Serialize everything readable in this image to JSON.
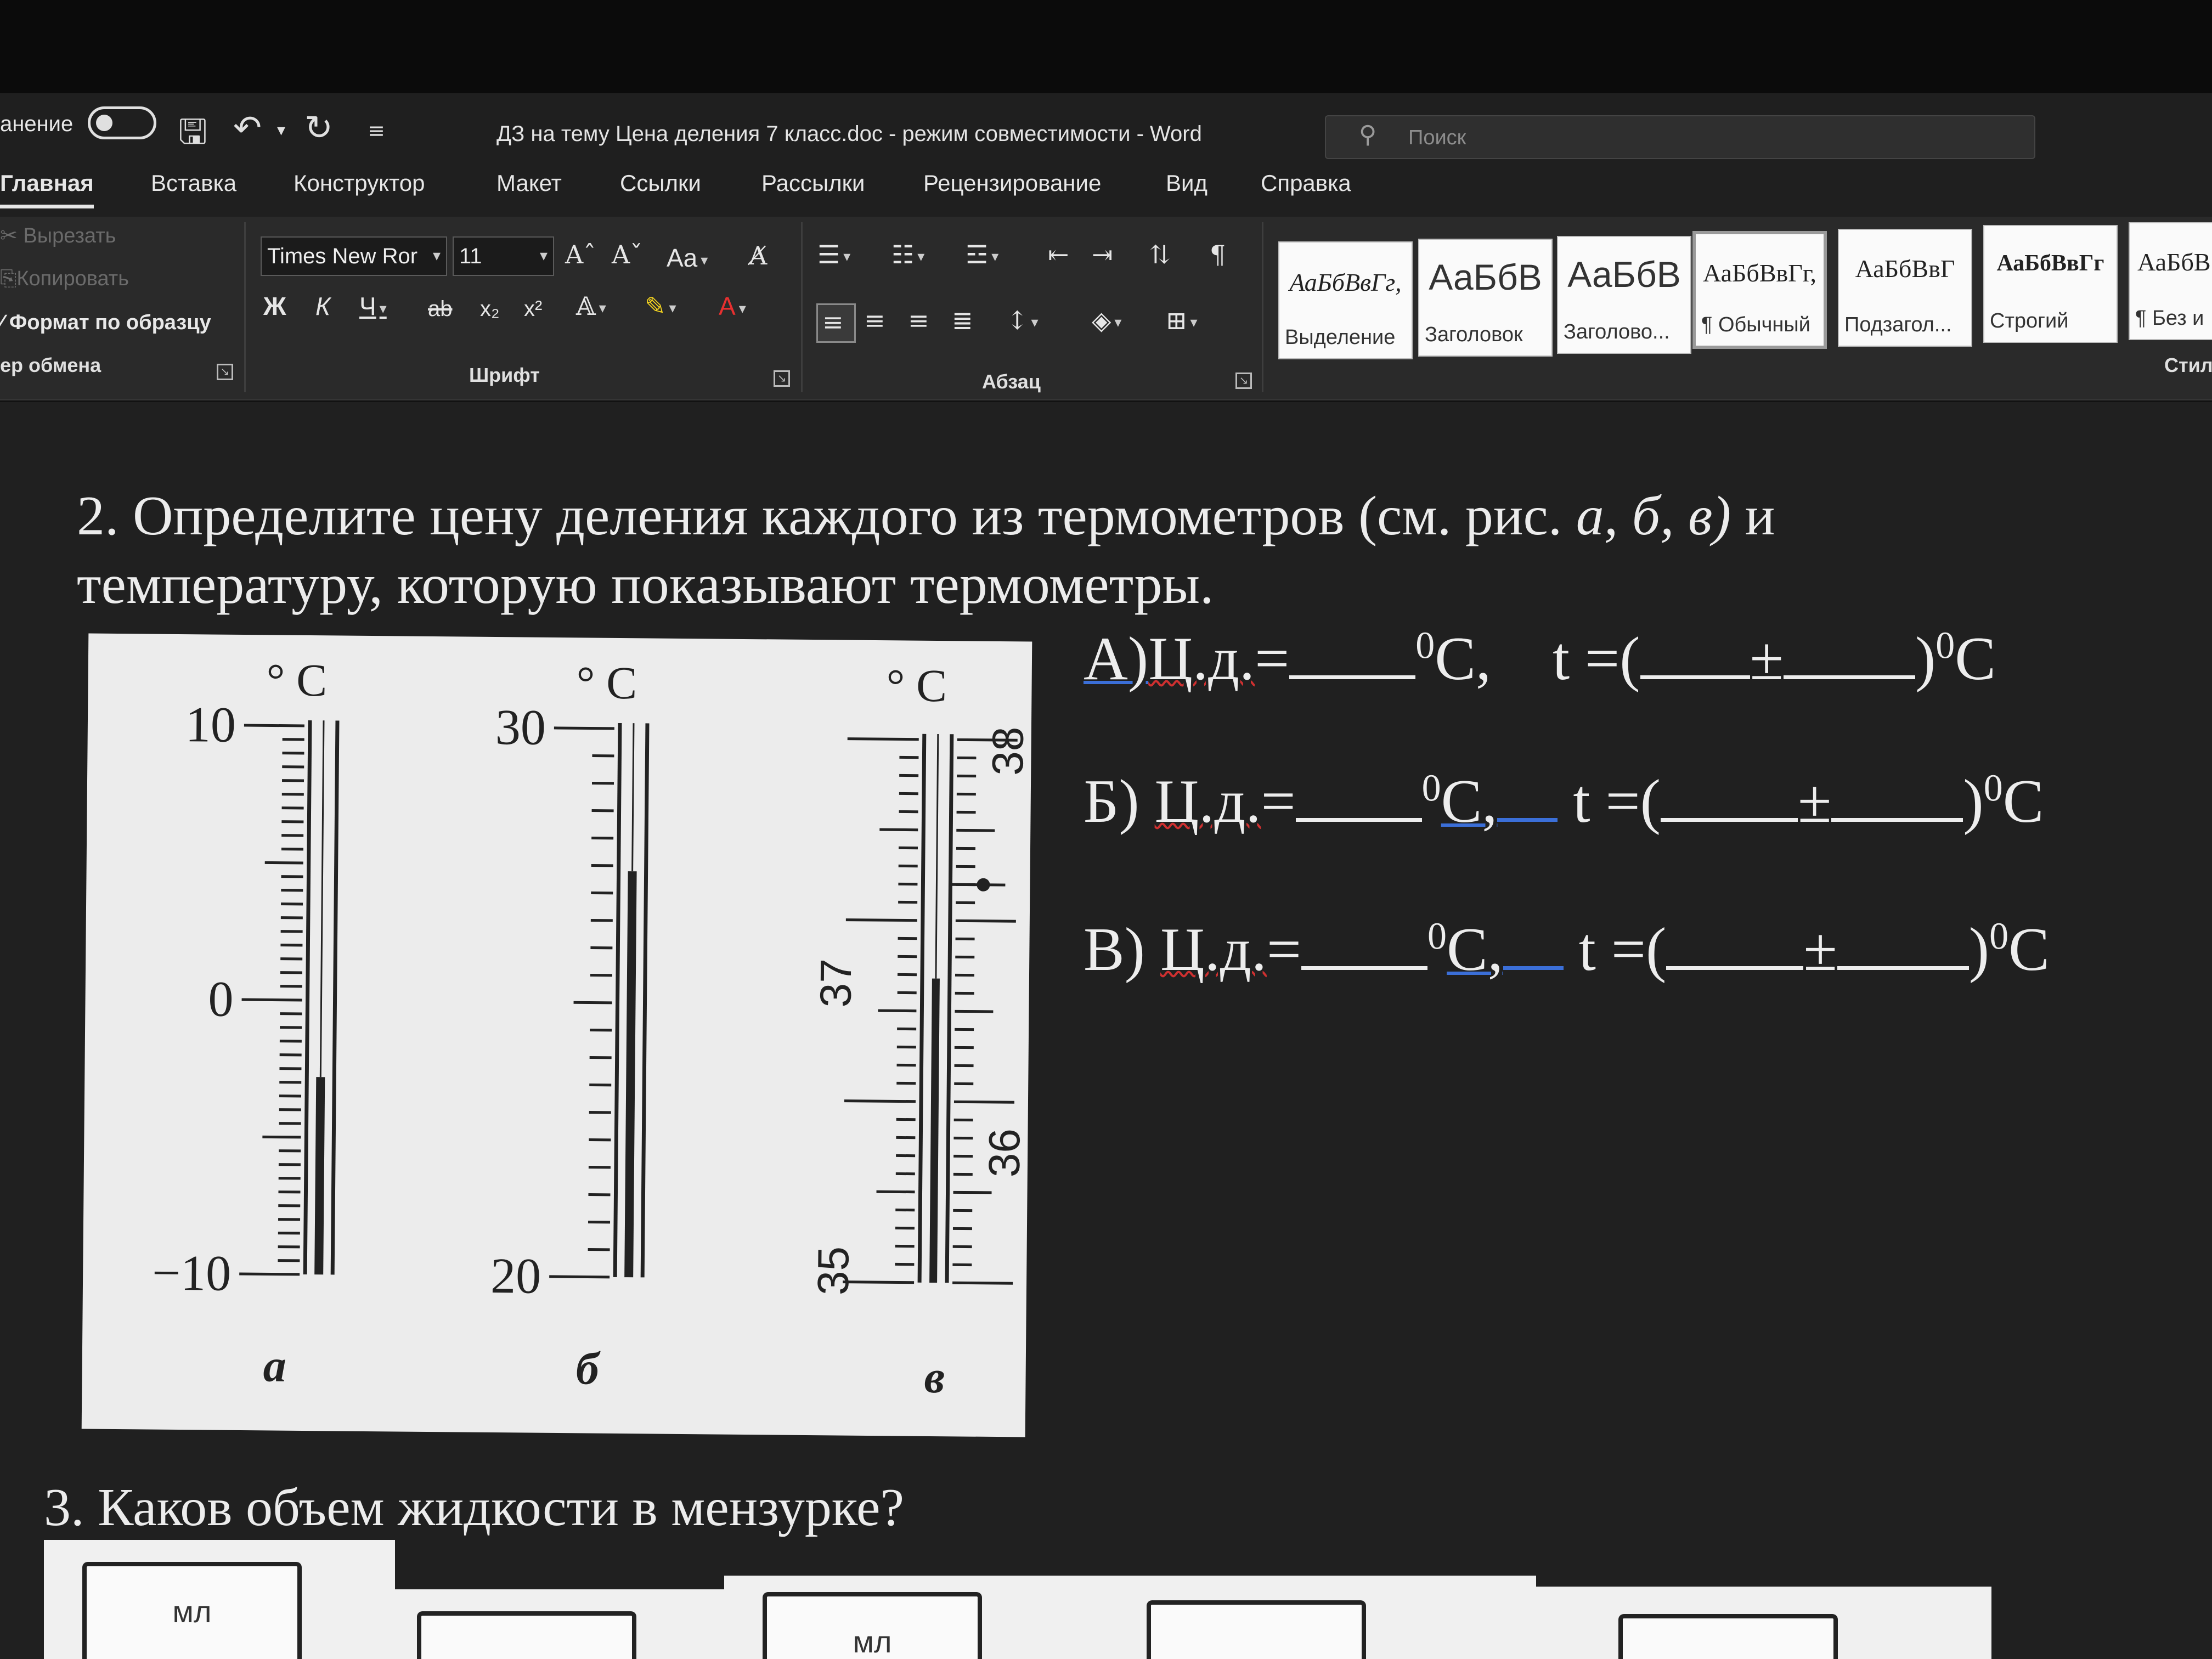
{
  "titlebar": {
    "autosave_label": "анение",
    "doc_title": "ДЗ на тему Цена деления 7 класс.doc  -  режим совместимости  -  Word",
    "search_placeholder": "Поиск"
  },
  "ribbon": {
    "tabs": [
      "Главная",
      "Вставка",
      "Конструктор",
      "Макет",
      "Ссылки",
      "Рассылки",
      "Рецензирование",
      "Вид",
      "Справка"
    ],
    "active_tab": "Главная",
    "clipboard": {
      "cut": "Вырезать",
      "copy": "Копировать",
      "format_painter": "Формат по образцу",
      "group_label": "ер обмена"
    },
    "font": {
      "name": "Times New Ror",
      "size": "11",
      "grow": "Aˆ",
      "shrink": "Aˇ",
      "case": "Aa",
      "bold": "Ж",
      "italic": "К",
      "underline": "Ч",
      "strike": "ab",
      "subscript": "x₂",
      "superscript": "x²",
      "group_label": "Шрифт"
    },
    "paragraph": {
      "group_label": "Абзац"
    },
    "styles": {
      "tiles": [
        {
          "sample": "АаБбВвГг,",
          "name": "Выделение"
        },
        {
          "sample": "АаБбВ",
          "name": "Заголовок"
        },
        {
          "sample": "АаБбВ",
          "name": "Заголово..."
        },
        {
          "sample": "АаБбВвГг,",
          "name": "¶ Обычный"
        },
        {
          "sample": "АаБбВвГ",
          "name": "Подзагол..."
        },
        {
          "sample": "АаБбВвГг",
          "name": "Строгий"
        },
        {
          "sample": "АаБбВ",
          "name": "¶ Без и"
        }
      ],
      "group_label": "Стил"
    }
  },
  "document": {
    "q2_number": "2.",
    "q2_line1": "Определите цену деления каждого из термометров (см. рис.",
    "q2_refs": "а, б, в)",
    "q2_line1_end": "и",
    "q2_line2": "температуру, которую показывают термометры.",
    "answers": [
      {
        "label": "А)",
        "cd": "Ц.д.",
        "eq": "=",
        "unit": "С,",
        "t": "t =(",
        "pm": "±",
        "end": ")",
        "end_unit": "С"
      },
      {
        "label": "Б)",
        "cd": "Ц.д.",
        "eq": "=",
        "unit": "С,",
        "t": "t =(",
        "pm": "±",
        "end": ")",
        "end_unit": "С"
      },
      {
        "label": "В)",
        "cd": "Ц.д.",
        "eq": "=",
        "unit": "С,",
        "t": "t =(",
        "pm": "±",
        "end": ")",
        "end_unit": "С"
      }
    ],
    "degree_sup": "0",
    "q3": "3. Каков объем жидкости в мензурке?",
    "beaker_unit": "мл"
  },
  "figure": {
    "unit_label": "° C",
    "thermometers": [
      {
        "caption": "а",
        "labels": [
          "10",
          "0",
          "−10"
        ],
        "range": [
          -10,
          10
        ],
        "reading_fraction": 0.36
      },
      {
        "caption": "б",
        "labels": [
          "30",
          "20"
        ],
        "range": [
          20,
          30
        ],
        "reading_fraction": 0.74
      },
      {
        "caption": "в",
        "labels": [
          "38",
          "37",
          "36",
          "35"
        ],
        "range": [
          35,
          38
        ],
        "reading_fraction": 0.56
      }
    ]
  }
}
